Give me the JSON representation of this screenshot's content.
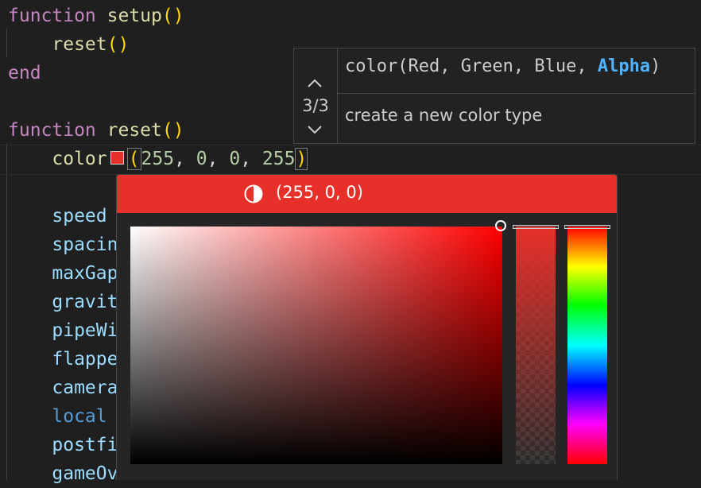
{
  "code": {
    "line1": {
      "kw": "function",
      "name": "setup",
      "parens": "()"
    },
    "line2": {
      "call": "reset",
      "parens": "()"
    },
    "line3": {
      "kw": "end"
    },
    "line5": {
      "kw": "function",
      "name": "reset",
      "parens": "()"
    },
    "line6": {
      "call": "color",
      "open": "(",
      "a": "255",
      "b": "0",
      "c": "0",
      "d": "255",
      "close": ")",
      "sep": ", "
    },
    "vars": [
      "speed",
      "spacin",
      "maxGap",
      "gravit",
      "pipeWi",
      "flappe",
      "camera",
      "local",
      "postfi",
      "gameOv"
    ]
  },
  "signature_help": {
    "counter": "3/3",
    "prefix": "color(Red, Green, Blue, ",
    "active_param": "Alpha",
    "suffix": ")",
    "doc": "create a new color type"
  },
  "color_picker": {
    "value_text": "(255, 0, 0)",
    "color": "#e8302a",
    "hue": 0,
    "saturation": 1.0,
    "brightness": 1.0,
    "alpha": 1.0
  }
}
